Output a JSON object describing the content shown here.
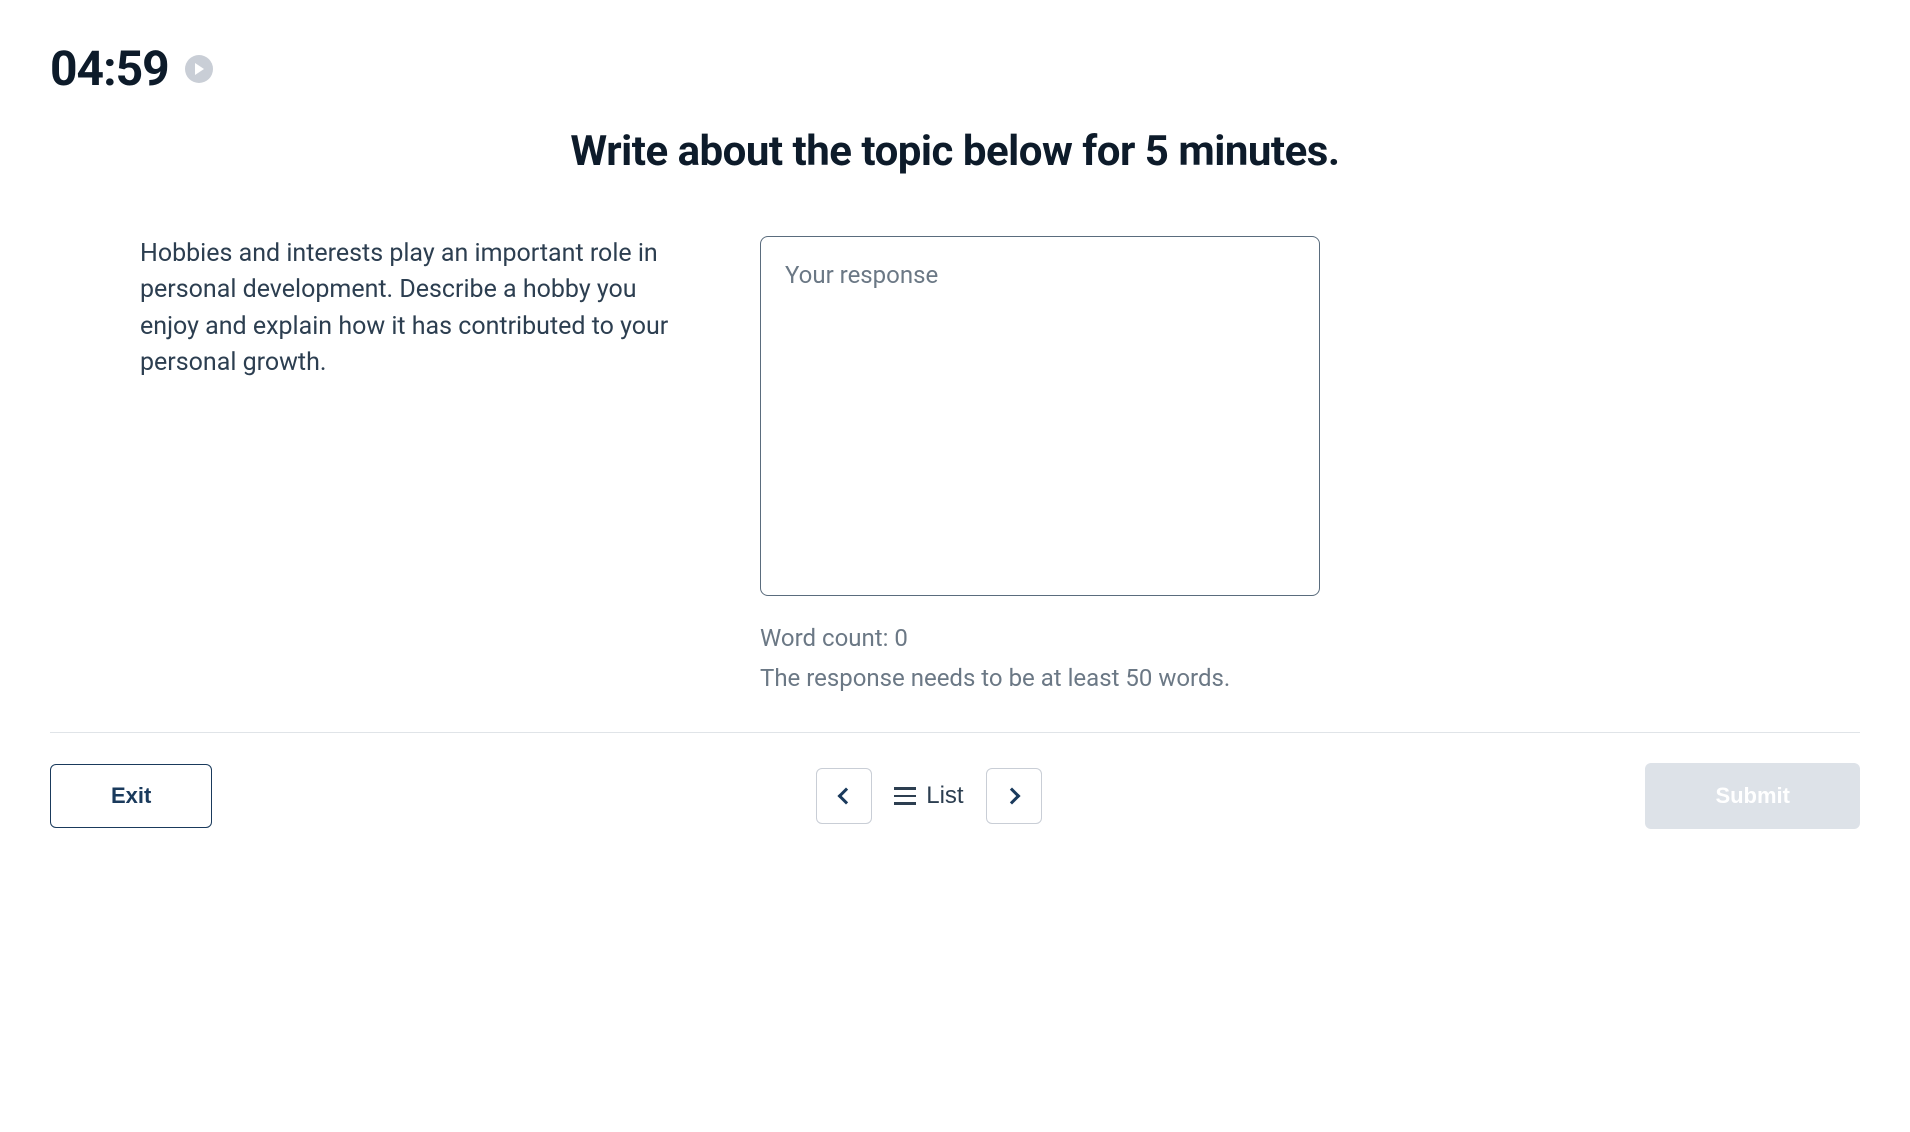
{
  "timer": {
    "display": "04:59"
  },
  "instruction": "Write about the topic below for 5 minutes.",
  "prompt": "Hobbies and interests play an important role in personal development. Describe a hobby you enjoy and explain how it has contributed to your personal growth.",
  "response": {
    "placeholder": "Your response",
    "value": "",
    "word_count_label": "Word count: 0",
    "min_words_hint": "The response needs to be at least 50 words."
  },
  "nav": {
    "exit_label": "Exit",
    "list_label": "List",
    "submit_label": "Submit"
  }
}
